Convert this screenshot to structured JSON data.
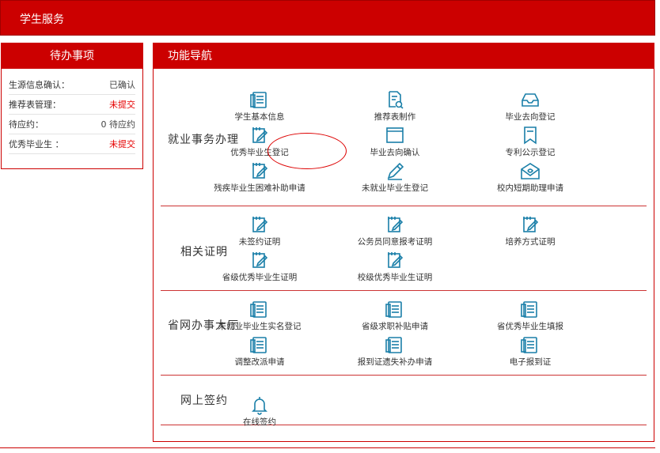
{
  "header": {
    "title": "学生服务"
  },
  "todo": {
    "title": "待办事项",
    "rows": [
      {
        "label": "生源信息确认：",
        "value": "已确认",
        "red": false
      },
      {
        "label": "推荐表管理：",
        "value": "未提交",
        "red": true
      },
      {
        "label": "待应约：",
        "value": "0 待应约",
        "red": false
      },
      {
        "label": "优秀毕业生 ：",
        "value": "未提交",
        "red": true
      }
    ]
  },
  "nav": {
    "title": "功能导航",
    "sections": [
      {
        "label": "就业事务办理",
        "items": [
          "学生基本信息",
          "推荐表制作",
          "毕业去向登记",
          "优秀毕业生登记",
          "毕业去向确认",
          "专利公示登记",
          "残疾毕业生困难补助申请",
          "未就业毕业生登记",
          "校内短期助理申请"
        ],
        "icons": [
          "doc-icon",
          "search-doc-icon",
          "inbox-icon",
          "edit-icon",
          "window-icon",
          "bookmark-icon",
          "edit-icon",
          "pen-icon",
          "envelope-icon"
        ]
      },
      {
        "label": "相关证明",
        "items": [
          "未签约证明",
          "公务员同意报考证明",
          "培养方式证明",
          "省级优秀毕业生证明",
          "校级优秀毕业生证明"
        ],
        "icons": [
          "edit-icon",
          "edit-icon",
          "edit-icon",
          "edit-icon",
          "edit-icon"
        ]
      },
      {
        "label": "省网办事大厅",
        "items": [
          "未就业毕业生实名登记",
          "省级求职补贴申请",
          "省优秀毕业生填报",
          "调整改派申请",
          "报到证遗失补办申请",
          "电子报到证"
        ],
        "icons": [
          "doc-icon",
          "doc-icon",
          "doc-icon",
          "doc-icon",
          "doc-icon",
          "doc-icon"
        ]
      },
      {
        "label": "网上签约",
        "items": [
          "在线签约"
        ],
        "icons": [
          "bell-icon"
        ]
      }
    ]
  },
  "colors": {
    "brand": "#cc0000",
    "icon": "#1a7fa8",
    "alert": "#e60000"
  }
}
